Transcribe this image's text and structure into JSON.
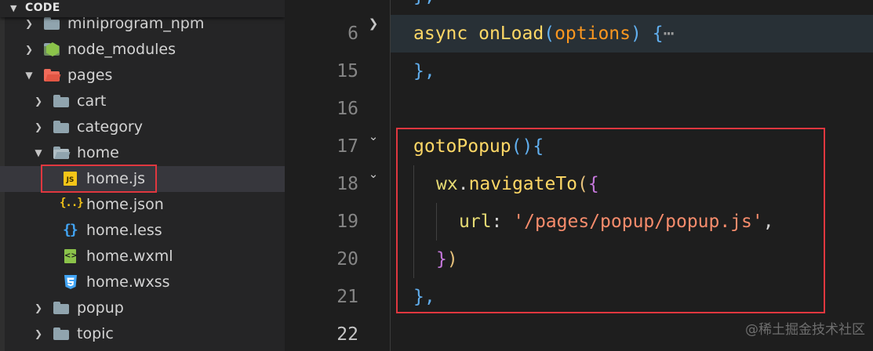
{
  "explorer": {
    "section_title": "CODE",
    "items": [
      {
        "label": "miniprogram_npm",
        "icon": "folder-icon",
        "expanded": false
      },
      {
        "label": "node_modules",
        "icon": "node-modules-folder-icon",
        "expanded": false
      },
      {
        "label": "pages",
        "icon": "pages-folder-icon",
        "expanded": true
      },
      {
        "label": "cart",
        "icon": "folder-icon",
        "expanded": false
      },
      {
        "label": "category",
        "icon": "folder-icon",
        "expanded": false
      },
      {
        "label": "home",
        "icon": "folder-open-icon",
        "expanded": true
      },
      {
        "label": "home.js",
        "icon": "js-file-icon",
        "icon_text": "JS",
        "selected": true
      },
      {
        "label": "home.json",
        "icon": "json-file-icon",
        "icon_text": "{..}"
      },
      {
        "label": "home.less",
        "icon": "less-file-icon",
        "icon_text": "{}"
      },
      {
        "label": "home.wxml",
        "icon": "wxml-file-icon",
        "icon_text": "<>"
      },
      {
        "label": "home.wxss",
        "icon": "wxss-file-icon"
      },
      {
        "label": "popup",
        "icon": "folder-icon",
        "expanded": false
      },
      {
        "label": "topic",
        "icon": "folder-icon",
        "expanded": false
      }
    ]
  },
  "editor": {
    "line_numbers": [
      "6",
      "15",
      "16",
      "17",
      "18",
      "19",
      "20",
      "21",
      "22"
    ],
    "active_line": "22",
    "code": {
      "l0": {
        "text": "},"
      },
      "l6": {
        "kw": "async",
        "fn": "onLoad",
        "open": "(",
        "param": "options",
        "close": ")",
        "brace": "{",
        "ellipsis": "⋯"
      },
      "l15": {
        "text": "},"
      },
      "l17": {
        "fn": "gotoPopup",
        "parens": "()",
        "brace": "{"
      },
      "l18": {
        "obj": "wx",
        "dot": ".",
        "fn": "navigateTo",
        "open": "(",
        "brace": "{"
      },
      "l19": {
        "key": "url",
        "colon": ":",
        "str": "'/pages/popup/popup.js'",
        "comma": ","
      },
      "l20": {
        "brace": "}",
        "close": ")"
      },
      "l21": {
        "text": "},"
      }
    }
  },
  "watermark": "@稀土掘金技术社区",
  "colors": {
    "highlight_box": "#e0373f",
    "sidebar_bg": "#252526",
    "editor_bg": "#1e1e1e"
  }
}
